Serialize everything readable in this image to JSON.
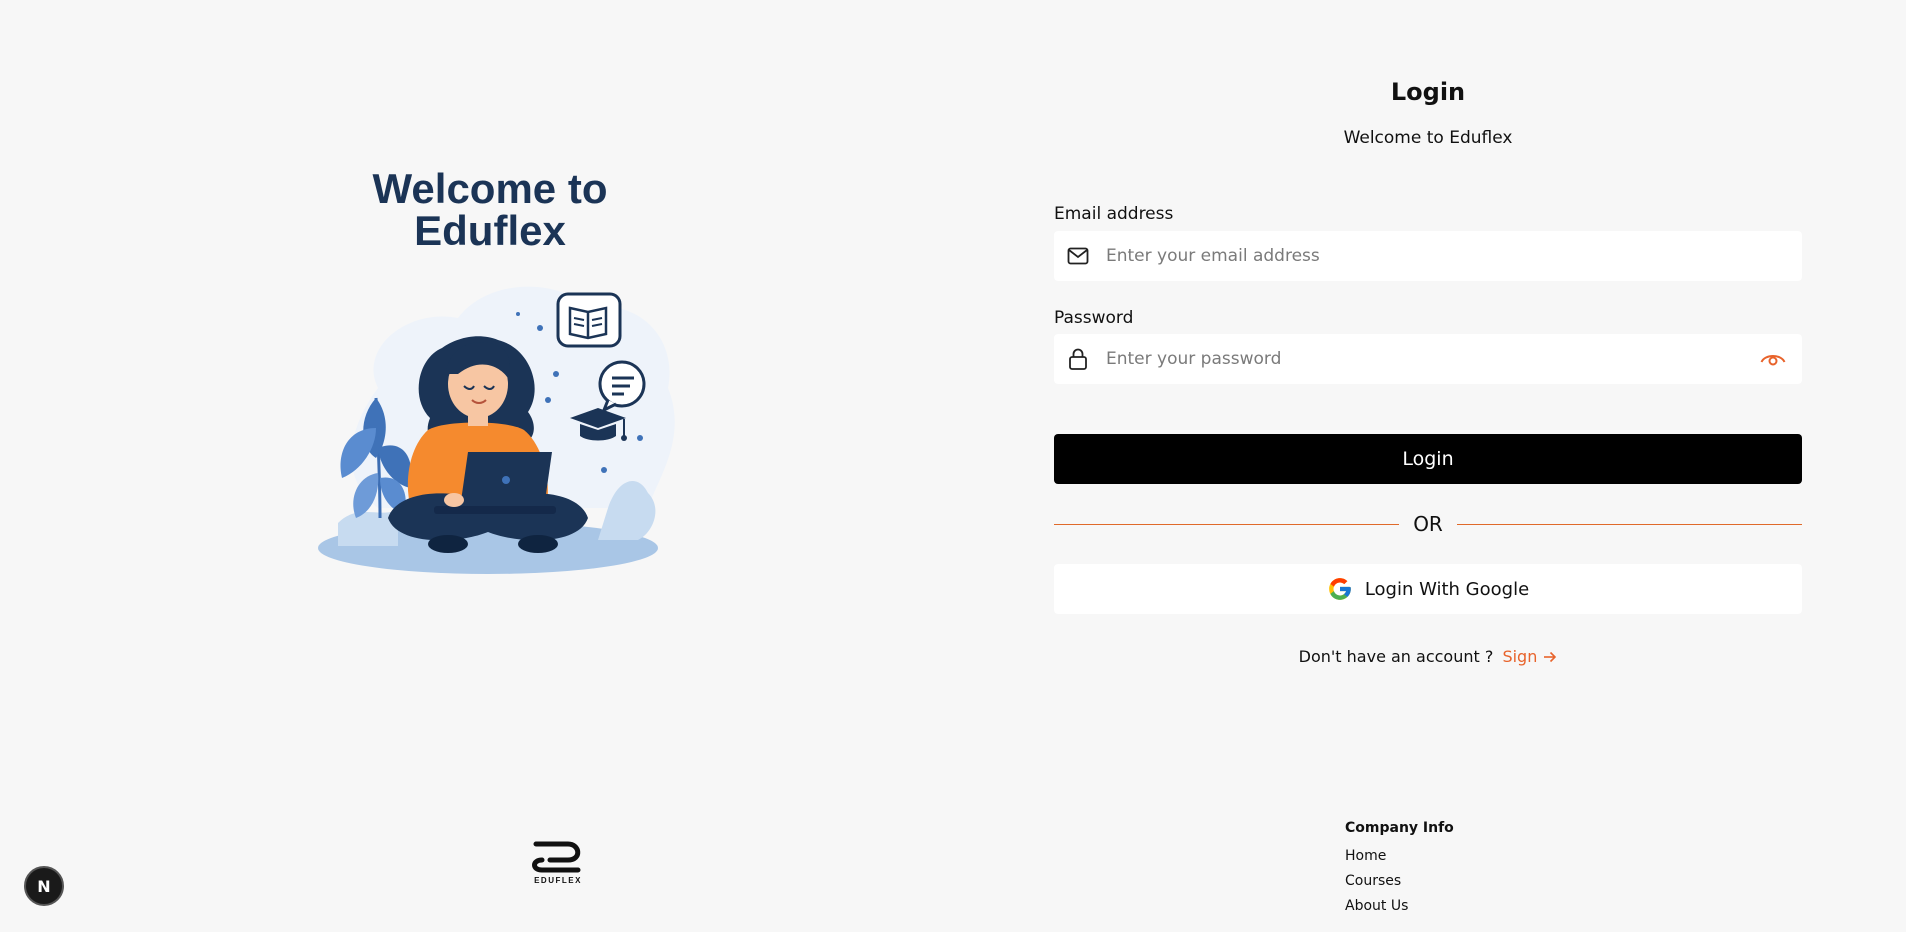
{
  "hero": {
    "title_line1": "Welcome to",
    "title_line2": "Eduflex"
  },
  "form": {
    "title": "Login",
    "subtitle": "Welcome to Eduflex",
    "email": {
      "label": "Email address",
      "placeholder": "Enter your email address",
      "value": "",
      "icon": "mail-icon"
    },
    "password": {
      "label": "Password",
      "placeholder": "Enter your password",
      "value": "",
      "icon": "lock-icon",
      "toggle_icon": "eye-icon"
    },
    "login_button": "Login",
    "divider_text": "OR",
    "google_button": "Login With Google",
    "signup_prompt": "Don't have an account ?",
    "signup_link": "Sign"
  },
  "footer": {
    "logo_text": "EDUFLEX",
    "company_info": {
      "heading": "Company Info",
      "links": [
        "Home",
        "Courses",
        "About Us"
      ]
    }
  },
  "badge": {
    "label": "N"
  },
  "colors": {
    "background": "#f7f7f7",
    "accent": "#e8632b",
    "hero_text": "#1b3456",
    "primary_button": "#000000"
  }
}
